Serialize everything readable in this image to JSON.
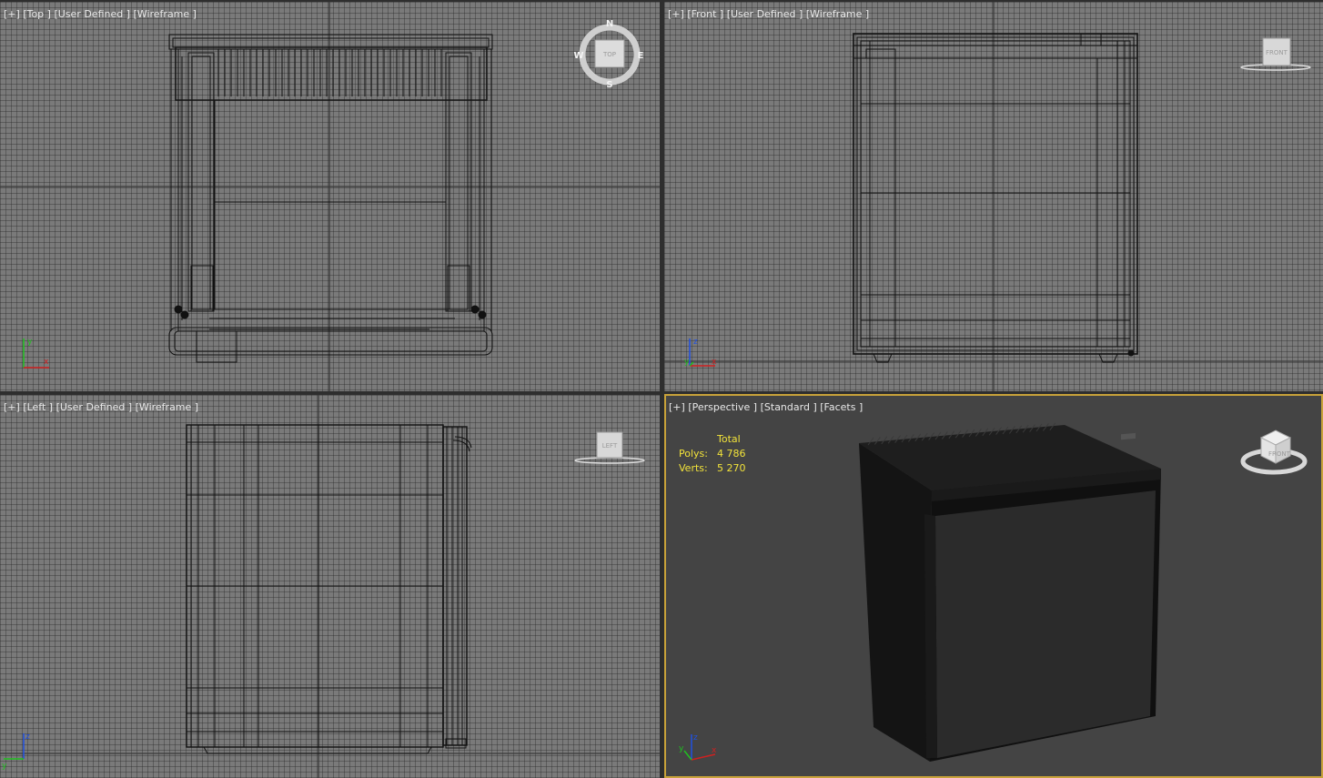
{
  "viewports": {
    "top": {
      "plus": "[+]",
      "view": "[Top ]",
      "preset": "[User Defined ]",
      "mode": "[Wireframe ]",
      "cube_label": "TOP",
      "compass": {
        "n": "N",
        "s": "S",
        "e": "E",
        "w": "W"
      }
    },
    "front": {
      "plus": "[+]",
      "view": "[Front ]",
      "preset": "[User Defined ]",
      "mode": "[Wireframe ]",
      "cube_label": "FRONT"
    },
    "left": {
      "plus": "[+]",
      "view": "[Left ]",
      "preset": "[User Defined ]",
      "mode": "[Wireframe ]",
      "cube_label": "LEFT"
    },
    "perspective": {
      "plus": "[+]",
      "view": "[Perspective ]",
      "preset": "[Standard ]",
      "mode": "[Facets ]",
      "cube_label": "FRONT",
      "stats": {
        "header": "Total",
        "polys_label": "Polys:",
        "polys_value": "4 786",
        "verts_label": "Verts:",
        "verts_value": "5 270"
      }
    }
  },
  "axis": {
    "x": "x",
    "y": "y",
    "z": "z"
  },
  "colors": {
    "grid_bg": "#7a7a7a",
    "persp_bg": "#444444",
    "active_border": "#c8a23a",
    "stats_text": "#f2e33a",
    "axis_x": "#d02020",
    "axis_y": "#20c020",
    "axis_z": "#2050e0",
    "wire": "#111111"
  }
}
